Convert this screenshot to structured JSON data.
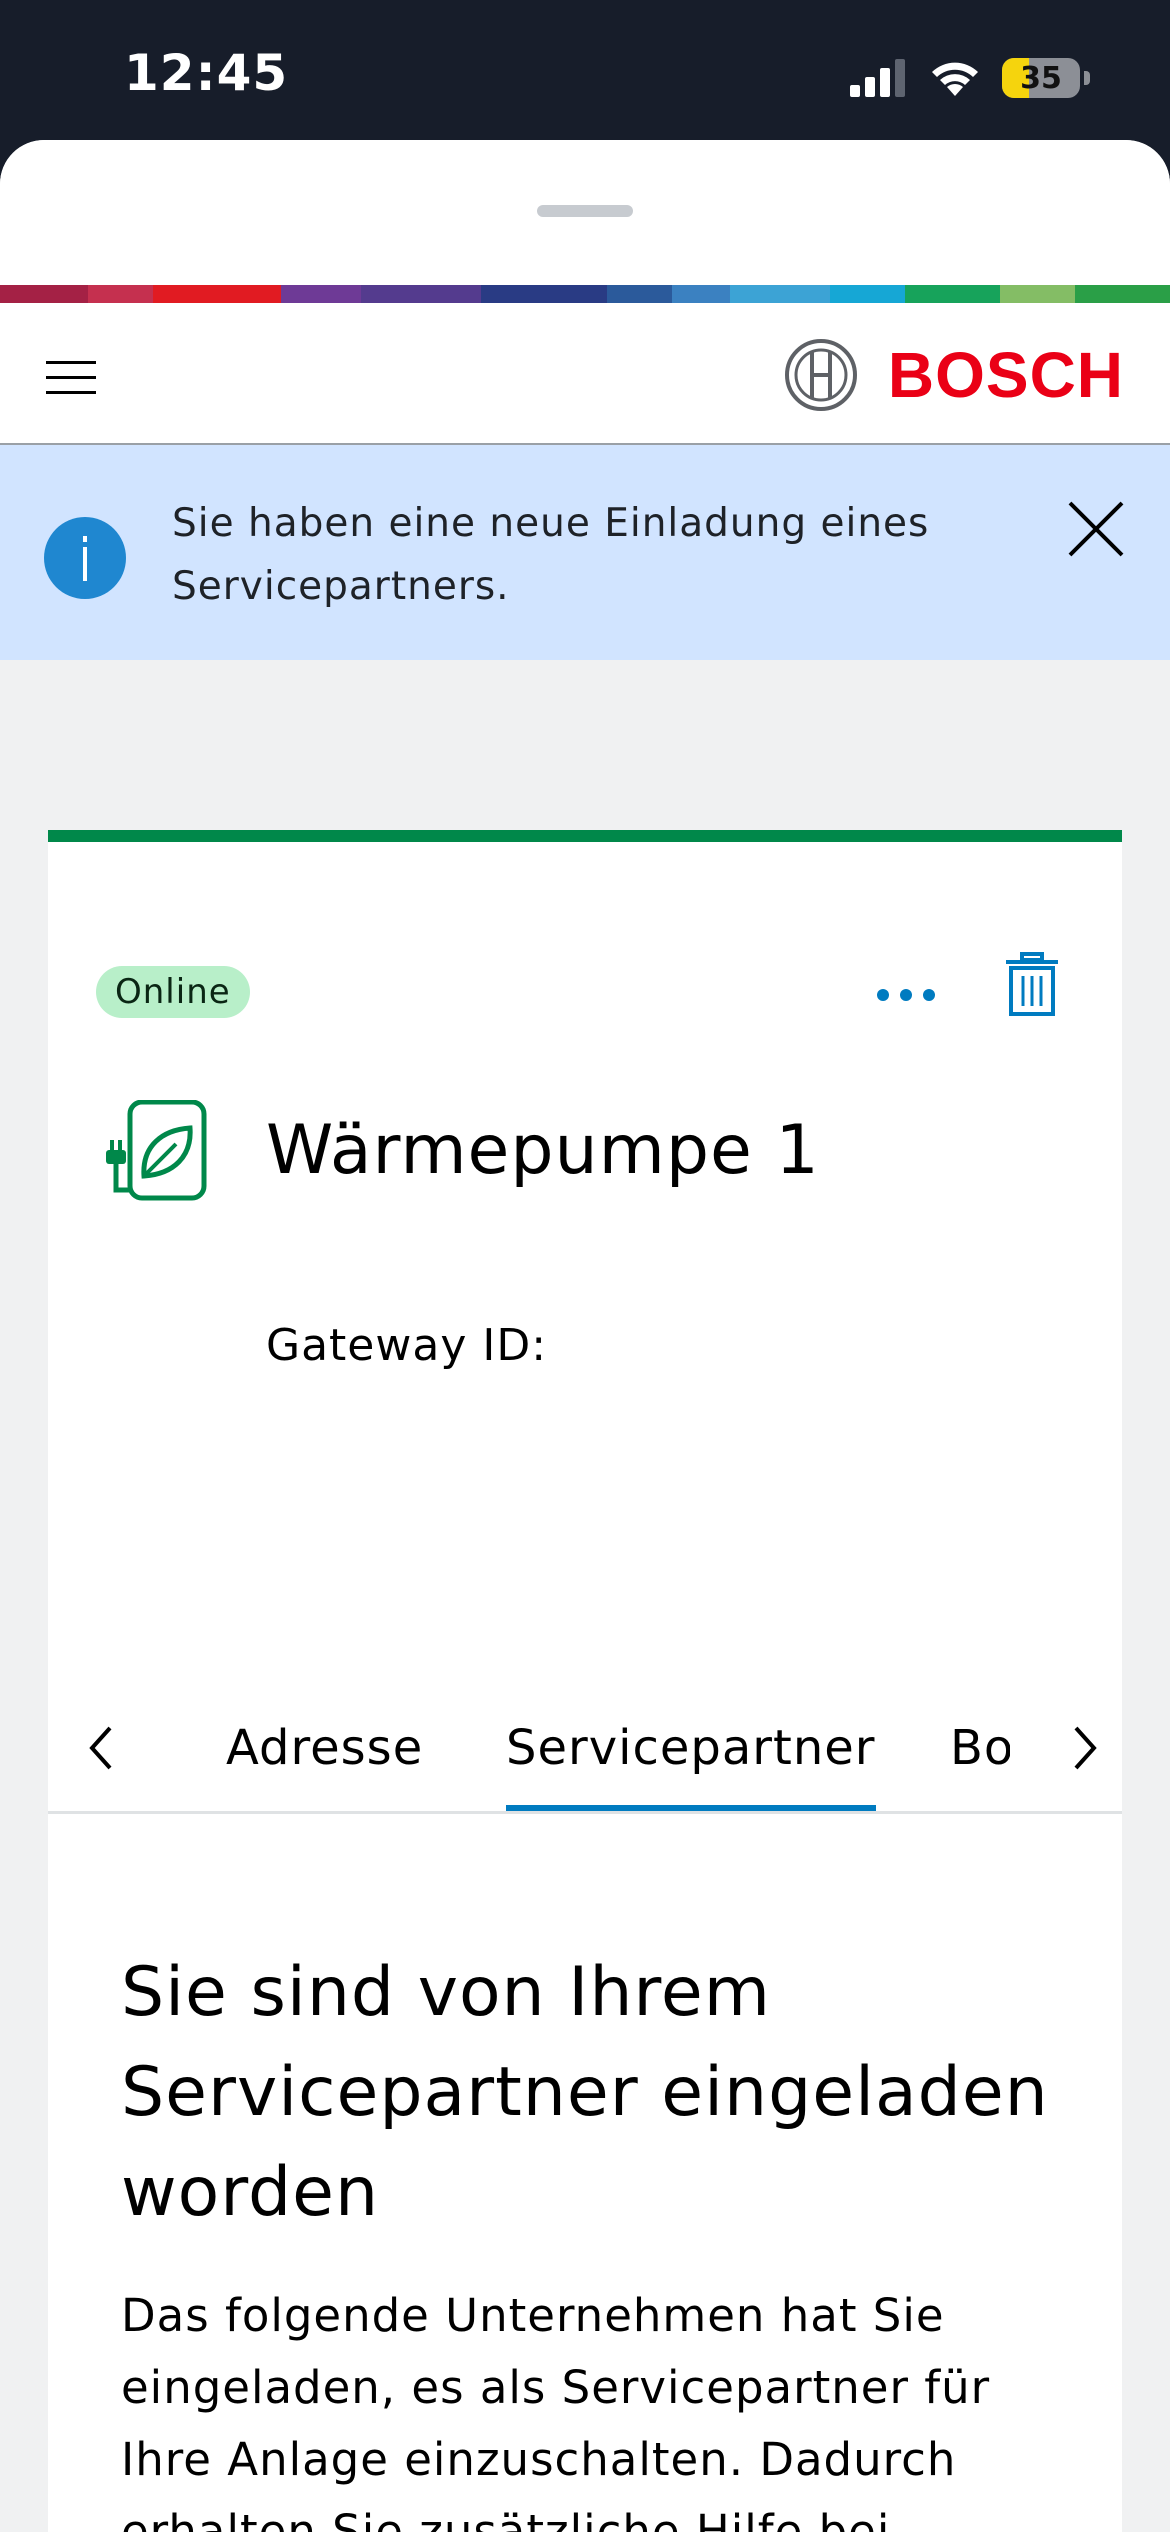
{
  "status_bar": {
    "time": "12:45",
    "battery_level": "35",
    "battery_fraction": 0.35
  },
  "header": {
    "brand": "BOSCH",
    "menu_icon": "hamburger-menu-icon",
    "logo_icon": "bosch-armature-icon"
  },
  "supergraphic_colors": [
    "#b12c4b",
    "#c5304f",
    "#e11b22",
    "#6e3a96",
    "#543b8e",
    "#293b84",
    "#2b5a9b",
    "#3b81c1",
    "#3ca3d5",
    "#16a7d5",
    "#17a35b",
    "#84bd65",
    "#2a9f47"
  ],
  "notice": {
    "text": "Sie haben eine neue Einladung eines Servicepartners.",
    "icon": "info-icon",
    "close_icon": "close-icon",
    "background": "#d1e4ff",
    "icon_color": "#1f87d0"
  },
  "device_card": {
    "accent_color": "#00884a",
    "status": "Online",
    "status_color": "#b8efc9",
    "title": "Wärmepumpe 1",
    "gateway_label": "Gateway ID:",
    "device_icon": "heat-pump-leaf-icon",
    "more_icon": "more-horizontal-icon",
    "delete_icon": "trash-icon"
  },
  "tabs": {
    "items": [
      {
        "label": "Adresse",
        "active": false
      },
      {
        "label": "Servicepartner",
        "active": true
      },
      {
        "label": "Bo",
        "active": false
      }
    ],
    "prev_icon": "chevron-left-icon",
    "next_icon": "chevron-right-icon",
    "active_color": "#007bc0"
  },
  "invitation": {
    "title": "Sie sind von Ihrem Servicepartner eingeladen worden",
    "body": "Das folgende Unternehmen hat Sie eingeladen, es als Servicepartner für Ihre Anlage einzuschalten. Dadurch erhalten Sie zusätzliche Hilfe bei Problemen, Ferndiagnose und"
  }
}
